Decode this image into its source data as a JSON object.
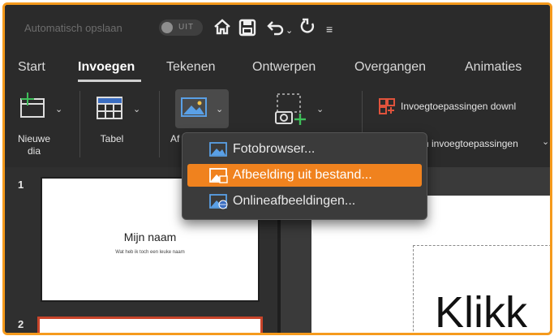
{
  "titlebar": {
    "autosave_label": "Automatisch opslaan",
    "autosave_state": "UIT",
    "icons": [
      "home-icon",
      "save-icon",
      "undo-icon",
      "chevron-down-icon",
      "redo-icon",
      "customize-icon"
    ]
  },
  "tabs": [
    {
      "label": "Start",
      "active": false
    },
    {
      "label": "Invoegen",
      "active": true
    },
    {
      "label": "Tekenen",
      "active": false
    },
    {
      "label": "Ontwerpen",
      "active": false
    },
    {
      "label": "Overgangen",
      "active": false
    },
    {
      "label": "Animaties",
      "active": false
    }
  ],
  "ribbon": {
    "new_slide_label_1": "Nieuwe",
    "new_slide_label_2": "dia",
    "table_label": "Tabel",
    "picture_label_partial": "Af",
    "addins_store": "Invoegtoepassingen downl",
    "my_addins": "n invoegtoepassingen"
  },
  "menu": {
    "items": [
      {
        "label": "Fotobrowser...",
        "icon": "photo-browser-icon",
        "highlighted": false
      },
      {
        "label": "Afbeelding uit bestand...",
        "icon": "picture-from-file-icon",
        "highlighted": true
      },
      {
        "label": "Onlineafbeeldingen...",
        "icon": "online-pictures-icon",
        "highlighted": false
      }
    ]
  },
  "slides": [
    {
      "number": "1",
      "title": "Mijn naam",
      "subtitle": "Wat heb ik toch een leuke naam"
    },
    {
      "number": "2"
    }
  ],
  "canvas": {
    "title_text": "Klikk"
  },
  "colors": {
    "accent": "#f0821e",
    "frame": "#f59a1c",
    "background": "#2b2b2b"
  }
}
